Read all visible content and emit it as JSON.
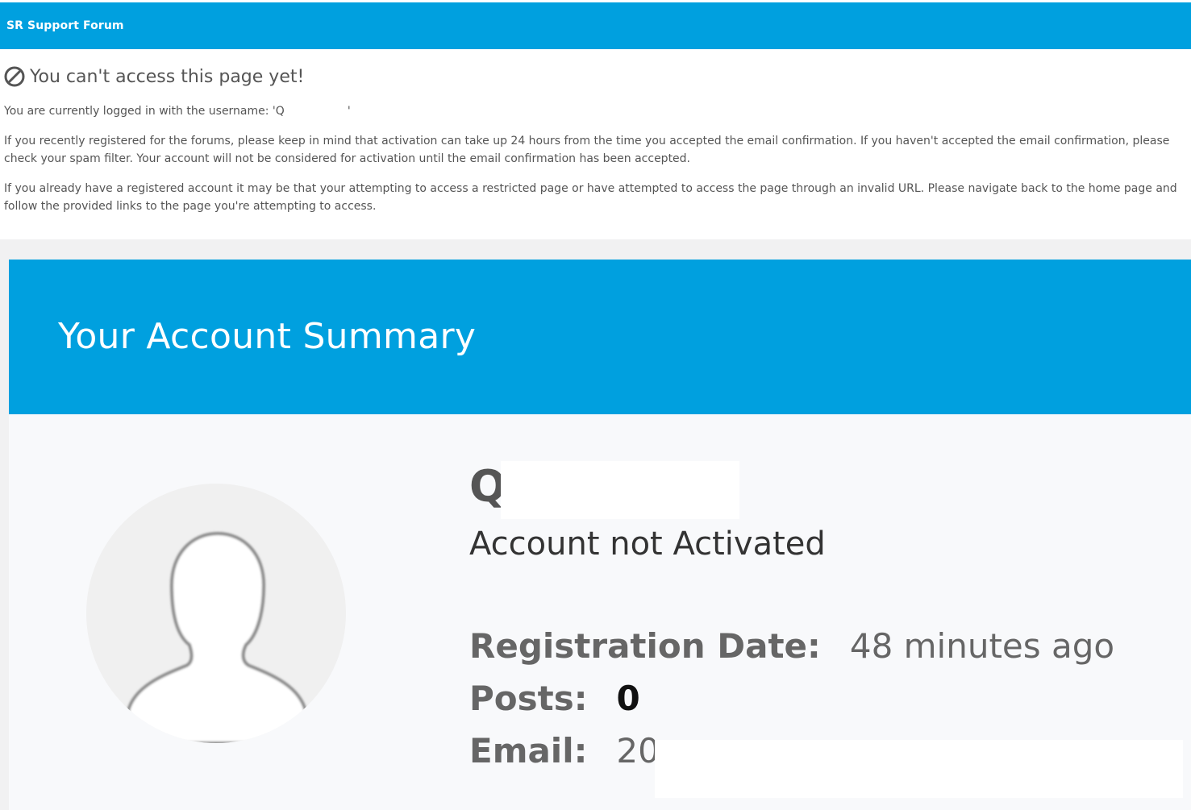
{
  "theme": {
    "brand": "#00a0df"
  },
  "header": {
    "brand": "SR Support Forum"
  },
  "notice": {
    "icon": "prohibited-icon",
    "title": "You can't access this page yet!",
    "username_line_prefix": "You are currently logged in with the username: 'Q",
    "username_line_suffix": "'",
    "registered_text": "If you recently registered for the forums, please keep in mind that activation can take up 24 hours from the time you accepted the email confirmation. If you haven't accepted the email confirmation, please check your spam filter. Your account will not be considered for activation until the email confirmation has been accepted.",
    "restricted_text": "If you already have a registered account it may be that your attempting to access a restricted page or have attempted to access the page through an invalid URL. Please navigate back to the home page and follow the provided links to the page you're attempting to access."
  },
  "summary": {
    "title": "Your Account Summary",
    "avatar_icon": "user-silhouette-icon",
    "name_initial": "Q",
    "status": "Account not Activated",
    "registration_label": "Registration Date:",
    "registration_value": "48 minutes ago",
    "posts_label": "Posts:",
    "posts_value": "0",
    "email_label": "Email:",
    "email_value": "20"
  }
}
